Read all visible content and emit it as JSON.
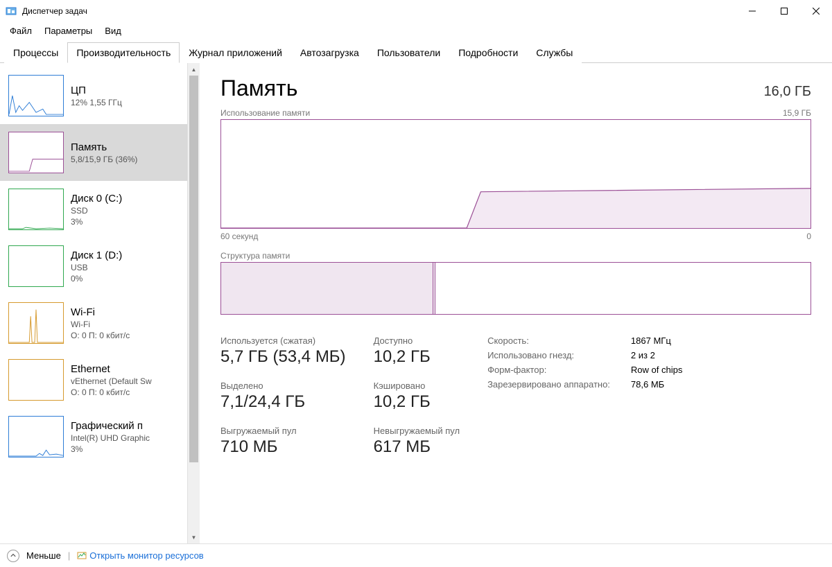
{
  "window": {
    "title": "Диспетчер задач"
  },
  "menu": {
    "file": "Файл",
    "options": "Параметры",
    "view": "Вид"
  },
  "tabs": {
    "processes": "Процессы",
    "performance": "Производительность",
    "apphistory": "Журнал приложений",
    "startup": "Автозагрузка",
    "users": "Пользователи",
    "details": "Подробности",
    "services": "Службы"
  },
  "sidebar": {
    "cpu": {
      "name": "ЦП",
      "sub1": "12%  1,55 ГГц"
    },
    "memory": {
      "name": "Память",
      "sub1": "5,8/15,9 ГБ (36%)"
    },
    "disk0": {
      "name": "Диск 0 (C:)",
      "sub1": "SSD",
      "sub2": "3%"
    },
    "disk1": {
      "name": "Диск 1 (D:)",
      "sub1": "USB",
      "sub2": "0%"
    },
    "wifi": {
      "name": "Wi-Fi",
      "sub1": "Wi-Fi",
      "sub2": "О: 0 П: 0 кбит/с"
    },
    "ethernet": {
      "name": "Ethernet",
      "sub1": "vEthernet (Default Sw",
      "sub2": "О: 0 П: 0 кбит/с"
    },
    "gpu": {
      "name": "Графический п",
      "sub1": "Intel(R) UHD Graphic",
      "sub2": "3%"
    }
  },
  "main": {
    "title": "Память",
    "total": "16,0 ГБ",
    "chart_label_left": "Использование памяти",
    "chart_label_right": "15,9 ГБ",
    "chart_axis_left": "60 секунд",
    "chart_axis_right": "0",
    "struct_label": "Структура памяти"
  },
  "stats": {
    "used_label": "Используется (сжатая)",
    "used_value": "5,7 ГБ (53,4 МБ)",
    "available_label": "Доступно",
    "available_value": "10,2 ГБ",
    "committed_label": "Выделено",
    "committed_value": "7,1/24,4 ГБ",
    "cached_label": "Кэшировано",
    "cached_value": "10,2 ГБ",
    "paged_label": "Выгружаемый пул",
    "paged_value": "710 МБ",
    "nonpaged_label": "Невыгружаемый пул",
    "nonpaged_value": "617 МБ"
  },
  "specs": {
    "speed_k": "Скорость:",
    "speed_v": "1867 МГц",
    "slots_k": "Использовано гнезд:",
    "slots_v": "2 из 2",
    "form_k": "Форм-фактор:",
    "form_v": "Row of chips",
    "hwreserved_k": "Зарезервировано аппаратно:",
    "hwreserved_v": "78,6 МБ"
  },
  "footer": {
    "fewer": "Меньше",
    "open_monitor": "Открыть монитор ресурсов"
  },
  "colors": {
    "memory_accent": "#9b4f96",
    "cpu_accent": "#2e7dd6",
    "network_accent": "#d69a2e",
    "disk_accent": "#2fa84f"
  },
  "chart_data": {
    "type": "line",
    "title": "Использование памяти",
    "xlabel": "60 секунд → 0",
    "ylabel": "ГБ",
    "ylim": [
      0,
      15.9
    ],
    "x_seconds": [
      60,
      55,
      50,
      45,
      40,
      35,
      30,
      25,
      20,
      15,
      10,
      5,
      0
    ],
    "series": [
      {
        "name": "Используется",
        "values_gb": [
          0,
          0,
          0,
          0,
          0,
          0,
          0,
          5.4,
          5.7,
          5.7,
          5.7,
          5.7,
          5.7
        ]
      }
    ],
    "memory_composition": {
      "in_use_gb": 5.7,
      "compressed_mb": 53.4,
      "available_gb": 10.2,
      "cached_gb": 10.2,
      "total_gb": 15.9
    }
  }
}
